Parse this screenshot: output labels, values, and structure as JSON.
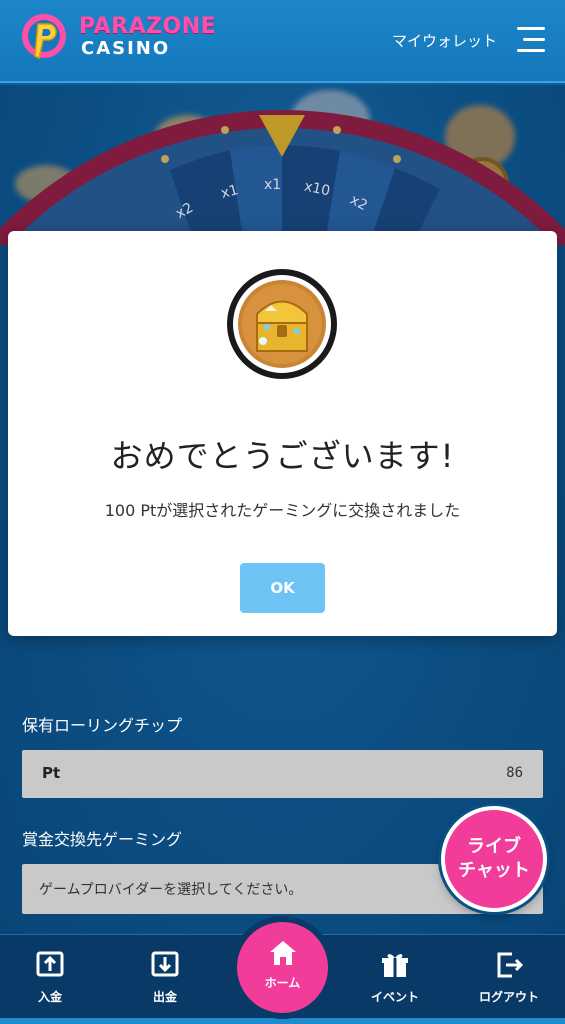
{
  "header": {
    "logo_line1": "PARAZONE",
    "logo_line2": "CASINO",
    "wallet_label": "マイウォレット",
    "menu_icon": "hamburger-menu-icon"
  },
  "wheel": {
    "segments": [
      "x2",
      "x1",
      "x1",
      "x10",
      "x2"
    ]
  },
  "modal": {
    "icon": "treasure-chest-icon",
    "title": "おめでとうございます!",
    "message": "100 Ptが選択されたゲーミングに交換されました",
    "ok_label": "OK"
  },
  "form": {
    "rolling_chip_label": "保有ローリングチップ",
    "pt_label": "Pt",
    "pt_value": "86",
    "exchange_label": "賞金交換先ゲーミング",
    "provider_placeholder": "ゲームプロバイダーを選択してください。"
  },
  "live_chat": {
    "line1": "ライブ",
    "line2": "チャット"
  },
  "bottom_nav": {
    "items": [
      {
        "label": "入金",
        "icon": "deposit-icon"
      },
      {
        "label": "出金",
        "icon": "withdraw-icon"
      },
      {
        "label": "ホーム",
        "icon": "home-icon"
      },
      {
        "label": "イベント",
        "icon": "gift-icon"
      },
      {
        "label": "ログアウト",
        "icon": "logout-icon"
      }
    ]
  },
  "colors": {
    "header_blue": "#1578bb",
    "accent_pink": "#f13c9a",
    "ok_button": "#6ec3f5",
    "nav_dark": "#093a67"
  }
}
